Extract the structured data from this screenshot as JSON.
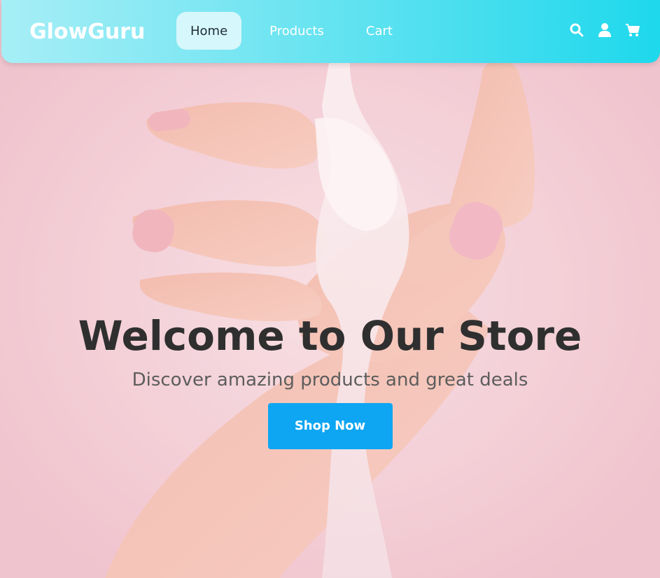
{
  "brand": {
    "name": "GlowGuru"
  },
  "nav": {
    "links": [
      {
        "label": "Home",
        "active": true
      },
      {
        "label": "Products",
        "active": false
      },
      {
        "label": "Cart",
        "active": false
      }
    ],
    "icons": [
      "search-icon",
      "user-icon",
      "cart-icon"
    ]
  },
  "hero": {
    "title": "Welcome to Our Store",
    "subtitle": "Discover amazing products and great deals",
    "cta_label": "Shop Now"
  },
  "colors": {
    "navbar_gradient_start": "#a7eef6",
    "navbar_gradient_end": "#1ed8ec",
    "active_link_bg": "#d6f7fb",
    "cta_bg": "#0ea5f2",
    "hero_bg": "#f5d5dc",
    "title_text": "#2f2f2f"
  }
}
